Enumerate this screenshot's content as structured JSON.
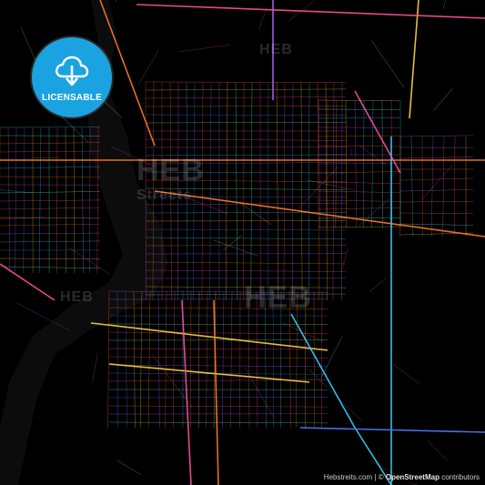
{
  "badge": {
    "label": "LICENSABLE",
    "icon": "cloud-download-icon",
    "color": "#1aa3e0"
  },
  "watermark": {
    "brand": "HEB",
    "secondary": "Streets"
  },
  "attribution": {
    "site": "Hebstreits.com",
    "separator": "|",
    "copyright": "©",
    "provider": "OpenStreetMap",
    "suffix": "contributors"
  },
  "map": {
    "background": "#000000",
    "river_color": "#101010",
    "road_colors": [
      "#ff7a2a",
      "#ffd23f",
      "#37d0ff",
      "#ff4fa0",
      "#b266ff",
      "#4f7dff",
      "#ff5555",
      "#66ffcc"
    ]
  }
}
